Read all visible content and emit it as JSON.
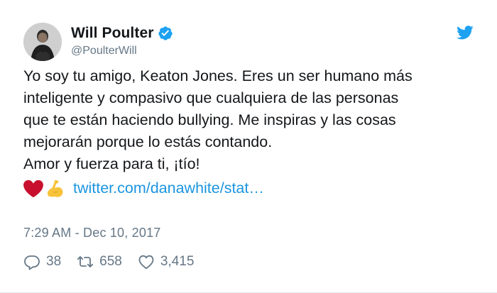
{
  "author": {
    "display_name": "Will Poulter",
    "handle": "@PoulterWill",
    "verified": true,
    "avatar_icon": "profile-photo"
  },
  "brand_icon": "twitter-bird-icon",
  "colors": {
    "brand_blue": "#1da1f2",
    "link": "#1b95e0",
    "verified_blue": "#1da1f2",
    "text": "#14171a",
    "muted": "#657786",
    "heart_emoji": "#c8102e",
    "flex_emoji": "#f7c33b"
  },
  "tweet": {
    "lines": [
      "Yo soy tu amigo, Keaton Jones. Eres un ser humano más",
      "inteligente y compasivo que cualquiera de las personas",
      "que te están haciendo bullying. Me inspiras y las cosas",
      "mejorarán porque lo estás contando.",
      "Amor y fuerza para ti, ¡tío!"
    ],
    "emojis": [
      "red-heart",
      "flexed-biceps"
    ],
    "link_text": "twitter.com/danawhite/stat…"
  },
  "timestamp": "7:29 AM - Dec 10, 2017",
  "actions": {
    "reply_count": "38",
    "retweet_count": "658",
    "like_count": "3,415"
  }
}
